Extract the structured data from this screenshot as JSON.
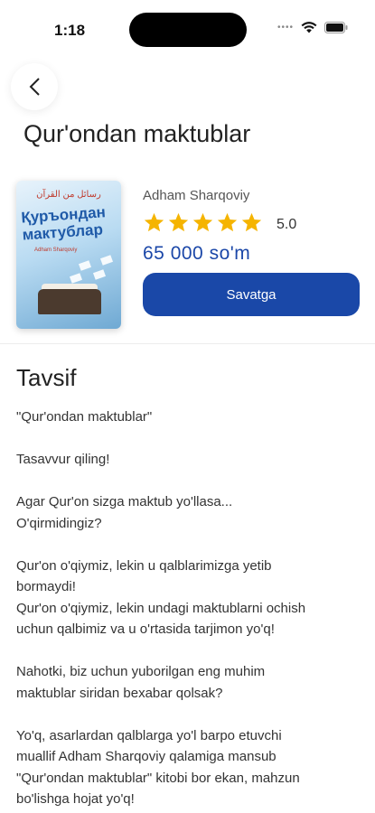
{
  "status_bar": {
    "time": "1:18"
  },
  "header": {
    "title": "Qur'ondan maktublar"
  },
  "book": {
    "cover": {
      "arabic_text": "رسائل من القرآن",
      "title_text": "Қуръондан мактублар",
      "author_small": "Adham Sharqoviy"
    },
    "author": "Adham Sharqoviy",
    "rating": 5,
    "rating_label": "5.0",
    "price": "65 000 so'm",
    "cart_label": "Savatga"
  },
  "description": {
    "title": "Tavsif",
    "lines": [
      "\"Qur'ondan maktublar\"",
      "",
      "Tasavvur qiling!",
      "",
      "Agar Qur'on sizga maktub yo'llasa...",
      "O'qirmidingiz?",
      "",
      "Qur'on o'qiymiz, lekin u qalblarimizga yetib",
      "bormaydi!",
      "Qur'on o'qiymiz, lekin undagi maktublarni ochish",
      "uchun qalbimiz va u o'rtasida tarjimon yo'q!",
      "",
      "Nahotki, biz uchun yuborilgan eng muhim",
      "maktublar siridan bexabar qolsak?",
      "",
      "Yo'q, asarlardan qalblarga yo'l barpo etuvchi",
      "muallif Adham Sharqoviy qalamiga mansub",
      "\"Qur'ondan maktublar\" kitobi bor ekan, mahzun",
      "bo'lishga hojat yo'q!"
    ]
  },
  "colors": {
    "accent": "#1a48a8",
    "star": "#f5b400"
  }
}
